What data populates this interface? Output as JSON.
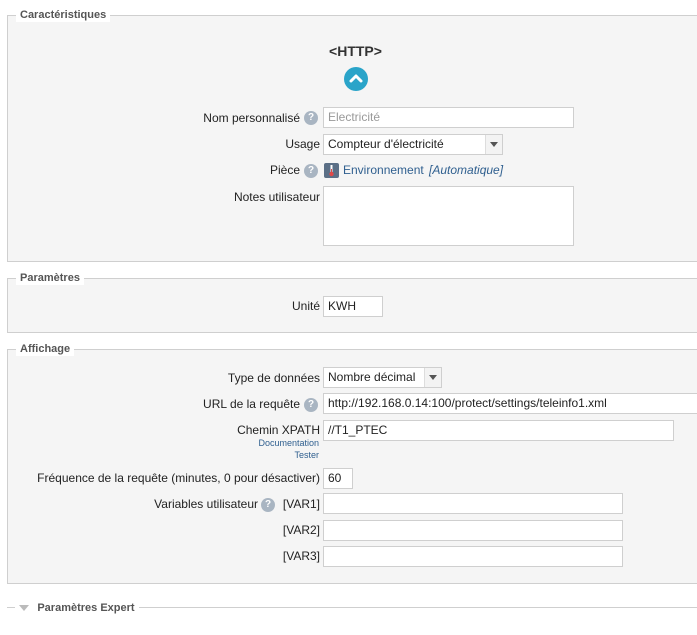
{
  "caracteristiques": {
    "legend": "Caractéristiques",
    "plugin_title": "<HTTP>",
    "nom_label": "Nom personnalisé",
    "nom_placeholder": "Electricité",
    "usage_label": "Usage",
    "usage_value": "Compteur d'électricité",
    "piece_label": "Pièce",
    "piece_value": "Environnement",
    "piece_auto": "[Automatique]",
    "notes_label": "Notes utilisateur"
  },
  "parametres": {
    "legend": "Paramètres",
    "unite_label": "Unité",
    "unite_value": "KWH"
  },
  "affichage": {
    "legend": "Affichage",
    "type_label": "Type de données",
    "type_value": "Nombre décimal",
    "url_label": "URL de la requête",
    "url_value": "http://192.168.0.14:100/protect/settings/teleinfo1.xml",
    "xpath_label": "Chemin XPATH",
    "xpath_doc": "Documentation",
    "xpath_test": "Tester",
    "xpath_value": "//T1_PTEC",
    "freq_label": "Fréquence de la requête (minutes, 0 pour désactiver)",
    "freq_value": "60",
    "vars_label": "Variables utilisateur",
    "var1_label": "[VAR1]",
    "var2_label": "[VAR2]",
    "var3_label": "[VAR3]"
  },
  "expert": {
    "legend": "Paramètres Expert"
  },
  "help_glyph": "?"
}
